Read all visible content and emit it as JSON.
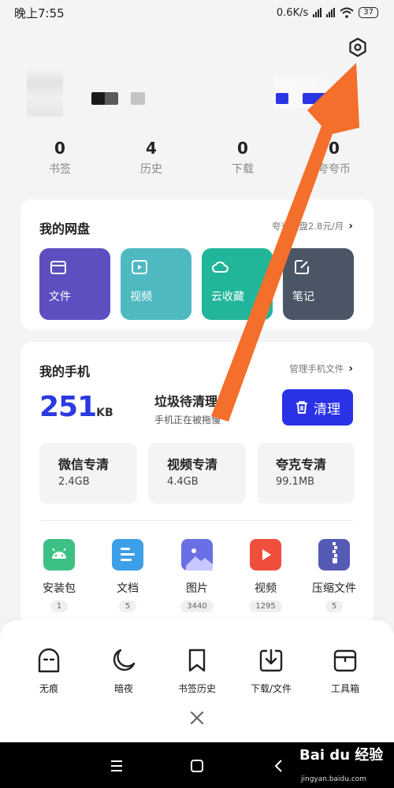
{
  "status": {
    "time": "晚上7:55",
    "speed": "0.6K/s",
    "battery": "37"
  },
  "colors": {
    "accent": "#2932e6",
    "storage_number": "#2b3ae0",
    "annotation_arrow": "#f36f2b"
  },
  "stats": [
    {
      "value": "0",
      "label": "书签"
    },
    {
      "value": "4",
      "label": "历史"
    },
    {
      "value": "0",
      "label": "下载"
    },
    {
      "value": "0",
      "label": "夸夸币"
    }
  ],
  "cloud_disk": {
    "title": "我的网盘",
    "promo": "夸克网盘2.8元/月",
    "tiles": [
      {
        "label": "文件",
        "icon": "folder-icon",
        "color": "#5e4fc0"
      },
      {
        "label": "视频",
        "icon": "play-icon",
        "color": "#4fb9c2"
      },
      {
        "label": "云收藏",
        "icon": "cloud-icon",
        "color": "#21b59a"
      },
      {
        "label": "笔记",
        "icon": "edit-icon",
        "color": "#4a5566"
      }
    ]
  },
  "phone": {
    "title": "我的手机",
    "manage_link": "管理手机文件",
    "storage_value": "251",
    "storage_unit": "KB",
    "junk_title": "垃圾待清理",
    "junk_sub": "手机正在被拖慢",
    "clean_label": "清理",
    "clean_tiles": [
      {
        "title": "微信专清",
        "size": "2.4GB"
      },
      {
        "title": "视频专清",
        "size": "4.4GB"
      },
      {
        "title": "夸克专清",
        "size": "99.1MB"
      }
    ],
    "categories": [
      {
        "label": "安装包",
        "count": "1",
        "icon": "android-icon",
        "color": "#3cc083"
      },
      {
        "label": "文档",
        "count": "5",
        "icon": "document-icon",
        "color": "#3d9fe8"
      },
      {
        "label": "图片",
        "count": "3440",
        "icon": "image-icon",
        "color": "#6a6fe6"
      },
      {
        "label": "视频",
        "count": "1295",
        "icon": "video-icon",
        "color": "#ef4f3c"
      },
      {
        "label": "压缩文件",
        "count": "5",
        "icon": "zip-icon",
        "color": "#555ab4"
      }
    ]
  },
  "bottom_sheet": {
    "items": [
      {
        "label": "无痕",
        "icon": "incognito-icon"
      },
      {
        "label": "暗夜",
        "icon": "moon-icon"
      },
      {
        "label": "书签历史",
        "icon": "bookmark-icon"
      },
      {
        "label": "下载/文件",
        "icon": "download-icon"
      },
      {
        "label": "工具箱",
        "icon": "toolbox-icon"
      }
    ]
  },
  "watermark": {
    "brand": "Bai du 经验",
    "url": "jingyan.baidu.com"
  }
}
